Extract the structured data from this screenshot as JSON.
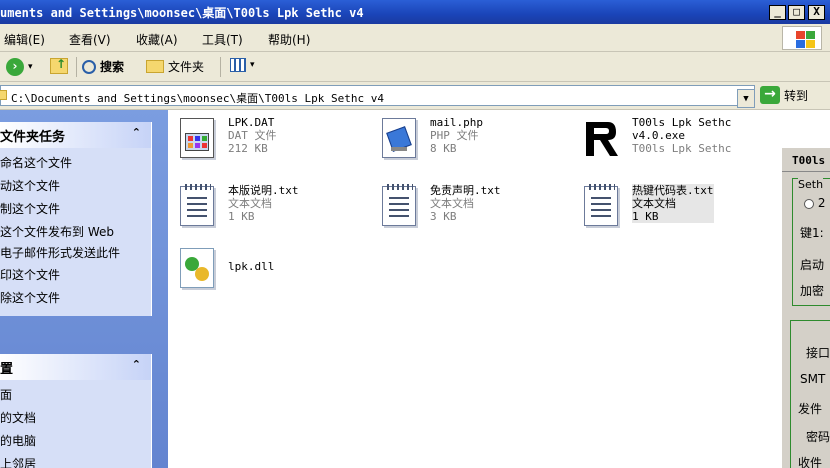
{
  "window": {
    "title": "uments and Settings\\moonsec\\桌面\\T00ls Lpk Sethc v4",
    "min_label": "_",
    "max_label": "□",
    "close_label": "X"
  },
  "menu": [
    {
      "label": "编辑(E)"
    },
    {
      "label": "查看(V)"
    },
    {
      "label": "收藏(A)"
    },
    {
      "label": "工具(T)"
    },
    {
      "label": "帮助(H)"
    }
  ],
  "toolbar": {
    "search_label": "搜索",
    "folders_label": "文件夹"
  },
  "address": {
    "path": "C:\\Documents and Settings\\moonsec\\桌面\\T00ls Lpk Sethc v4",
    "goto_label": "转到"
  },
  "tasks_panel": {
    "title": "文件夹任务",
    "items": [
      "命名这个文件",
      "动这个文件",
      "制这个文件",
      "这个文件发布到 Web",
      "电子邮件形式发送此件",
      "印这个文件",
      "除这个文件"
    ]
  },
  "places_panel": {
    "title": "置",
    "items": [
      "面",
      "的文档",
      "的电脑",
      "上邻居"
    ]
  },
  "files": [
    {
      "name": "LPK.DAT",
      "type": "DAT 文件",
      "size": "212 KB"
    },
    {
      "name": "mail.php",
      "type": "PHP 文件",
      "size": "8 KB"
    },
    {
      "name": "T00ls Lpk Sethc",
      "name2": "v4.0.exe",
      "type": "T00ls Lpk Sethc"
    },
    {
      "name": "本版说明.txt",
      "type": "文本文档",
      "size": "1 KB"
    },
    {
      "name": "免责声明.txt",
      "type": "文本文档",
      "size": "3 KB"
    },
    {
      "name": "热键代码表.txt",
      "type": "文本文档",
      "size": "1 KB"
    },
    {
      "name": "lpk.dll"
    }
  ],
  "dialog": {
    "title": "T00ls",
    "group1": "Seth",
    "radio": "2",
    "key_label": "键1:",
    "startup": "启动",
    "encrypt": "加密",
    "port": "接口",
    "smtp": "SMT",
    "sender": "发件",
    "password": "密码",
    "receiver": "收件"
  },
  "colors": {
    "titlebar": "#1a44b8",
    "chrome": "#ece9d8",
    "taskpane": "#6e8fd8",
    "panel": "#d6dff7"
  }
}
